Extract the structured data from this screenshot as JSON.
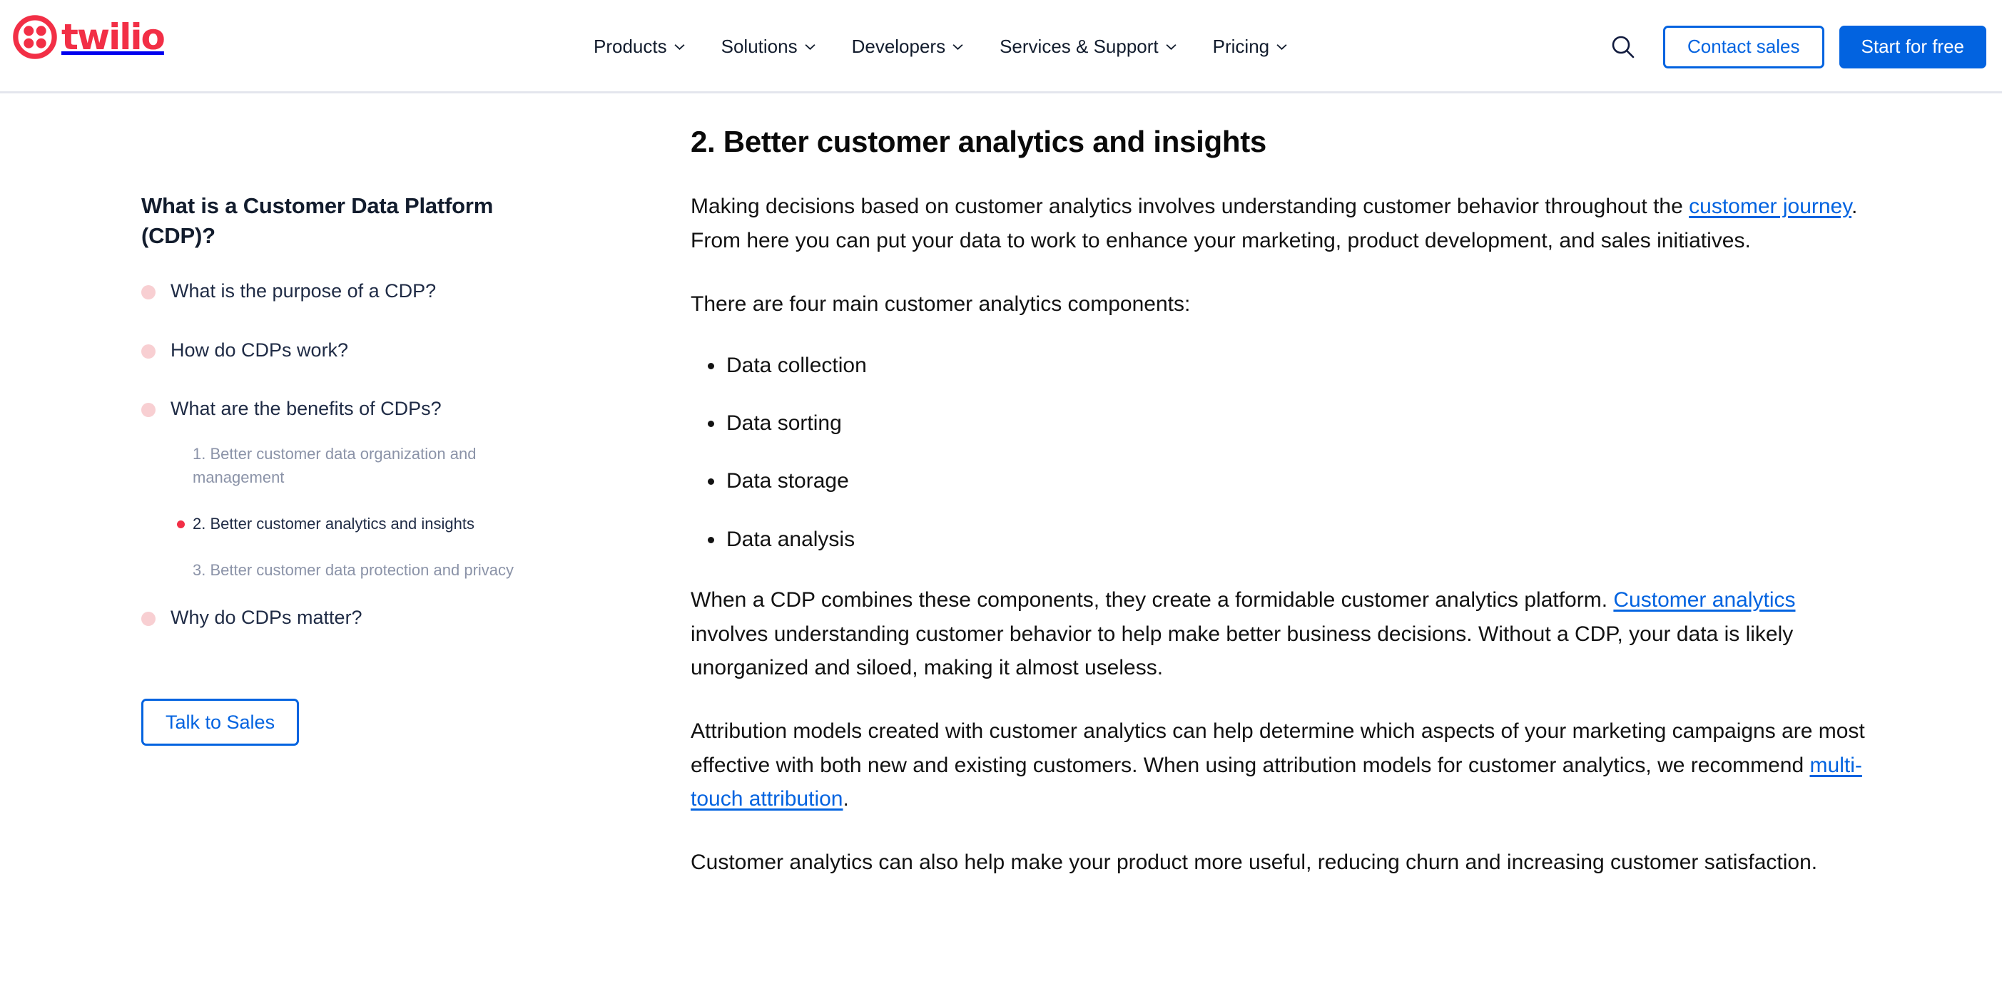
{
  "header": {
    "logo": {
      "wordmark": "twilio",
      "icon": "twilio-logo-icon",
      "color": "#f22f46"
    },
    "nav": [
      {
        "label": "Products",
        "icon": "chevron-down-icon"
      },
      {
        "label": "Solutions",
        "icon": "chevron-down-icon"
      },
      {
        "label": "Developers",
        "icon": "chevron-down-icon"
      },
      {
        "label": "Services & Support",
        "icon": "chevron-down-icon"
      },
      {
        "label": "Pricing",
        "icon": "chevron-down-icon"
      }
    ],
    "search_icon": "search-icon",
    "contact_sales_label": "Contact sales",
    "start_free_label": "Start for free",
    "accent_blue": "#0263e0",
    "nav_text_color": "#121c2d"
  },
  "sidebar": {
    "title": "What is a Customer Data Platform (CDP)?",
    "bullet_color": "#f8cfd2",
    "active_dot_color": "#f22f46",
    "items": [
      {
        "label": "What is the purpose of a CDP?",
        "active": false,
        "children": []
      },
      {
        "label": "How do CDPs work?",
        "active": false,
        "children": []
      },
      {
        "label": "What are the benefits of CDPs?",
        "active": false,
        "children": [
          {
            "label": "1. Better customer data organization and management",
            "active": false
          },
          {
            "label": "2. Better customer analytics and insights",
            "active": true
          },
          {
            "label": "3. Better customer data protection and privacy",
            "active": false
          }
        ]
      },
      {
        "label": "Why do CDPs matter?",
        "active": false,
        "children": []
      }
    ],
    "cta_label": "Talk to Sales"
  },
  "content": {
    "heading": "2. Better customer analytics and insights",
    "p1_a": "Making decisions based on customer analytics involves understanding customer behavior throughout the ",
    "p1_link": "customer journey",
    "p1_b": ". From here you can put your data to work to enhance your marketing, product development, and sales initiatives.",
    "p2": "There are four main customer analytics components:",
    "bullets": [
      "Data collection",
      "Data sorting",
      "Data storage",
      "Data analysis"
    ],
    "p3_a": "When a CDP combines these components, they create a formidable customer analytics platform. ",
    "p3_link": "Customer analytics",
    "p3_b": " involves understanding customer behavior to help make better business decisions. Without a CDP, your data is likely unorganized and siloed, making it almost useless.",
    "p4_a": "Attribution models created with customer analytics can help determine which aspects of your marketing campaigns are most effective with both new and existing customers. When using attribution models for customer analytics, we recommend ",
    "p4_link": "multi-touch attribution",
    "p4_b": ".",
    "p5": "Customer analytics can also help make your product more useful, reducing churn and increasing customer satisfaction."
  }
}
